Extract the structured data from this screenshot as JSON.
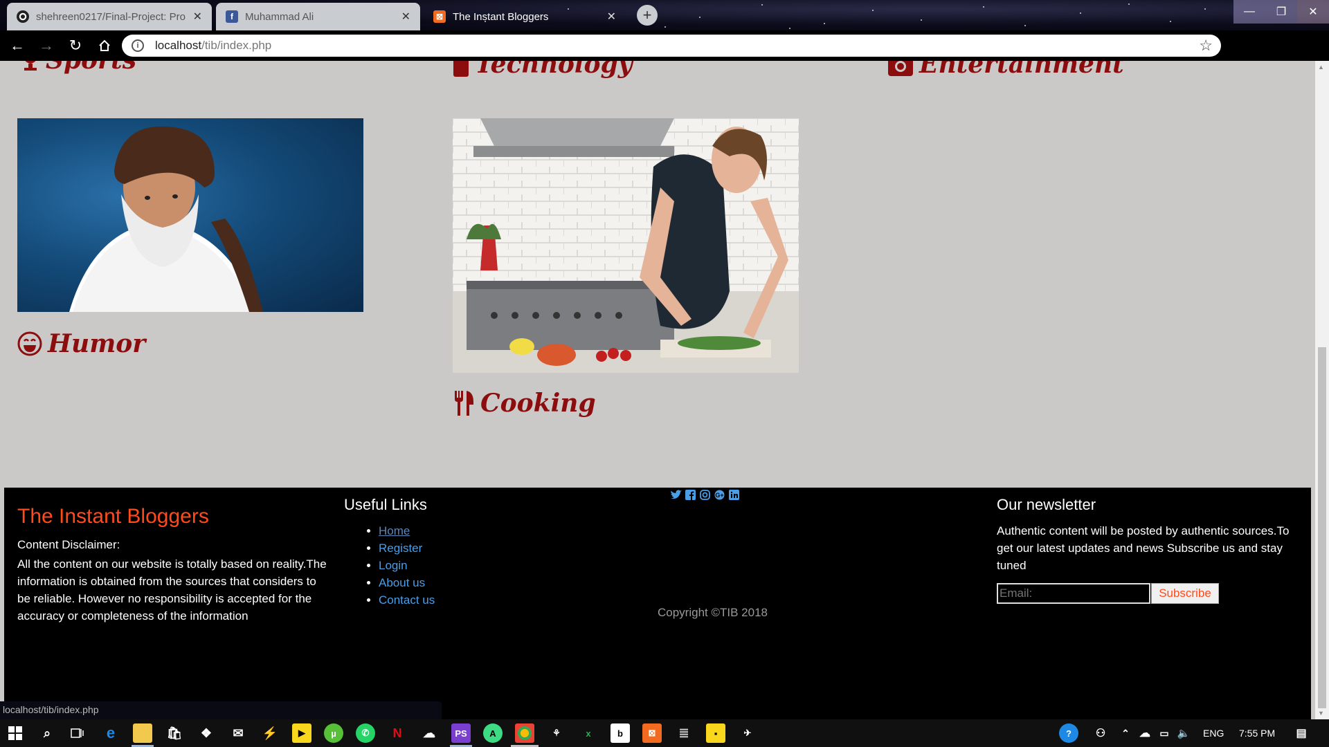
{
  "browser": {
    "tabs": [
      {
        "title": "shehreen0217/Final-Project: Pro",
        "icon": "github-icon"
      },
      {
        "title": "Muhammad Ali",
        "icon": "facebook-icon"
      },
      {
        "title": "The Instant Bloggers",
        "icon": "xampp-icon"
      }
    ],
    "new_tab": "+",
    "url_host": "localhost",
    "url_path": "/tib/index.php",
    "status_url": "localhost/tib/index.php"
  },
  "categories": [
    {
      "label": "Sports",
      "icon": "trophy-icon"
    },
    {
      "label": "Technology",
      "icon": "mobile-icon"
    },
    {
      "label": "Entertainment",
      "icon": "camera-icon"
    },
    {
      "label": "Humor",
      "icon": "laugh-icon"
    },
    {
      "label": "Cooking",
      "icon": "utensils-icon"
    }
  ],
  "footer": {
    "brand": "The Instant Bloggers",
    "disclaimer_title": "Content Disclaimer:",
    "disclaimer_text": "All the content on our website is totally based on reality.The information is obtained from the sources that considers to be reliable. However no responsibility is accepted for the accuracy or completeness of the information",
    "links_title": "Useful Links",
    "links": [
      "Home",
      "Register",
      "Login",
      "About us",
      "Contact us"
    ],
    "social": [
      "twitter-icon",
      "facebook-icon",
      "instagram-icon",
      "google-plus-icon",
      "linkedin-icon"
    ],
    "copyright": "Copyright ©TIB 2018",
    "newsletter_title": "Our newsletter",
    "newsletter_text": "Authentic content will be posted by authentic sources.To get our latest updates and news Subscribe us and stay tuned",
    "email_placeholder": "Email:",
    "subscribe_label": "Subscribe"
  },
  "taskbar": {
    "language": "ENG",
    "time": "7:55 PM"
  },
  "colors": {
    "page_bg": "#cbc8c8",
    "heading": "#8b0d0d",
    "brand": "#ff4a1c",
    "link": "#4a9ee8"
  }
}
